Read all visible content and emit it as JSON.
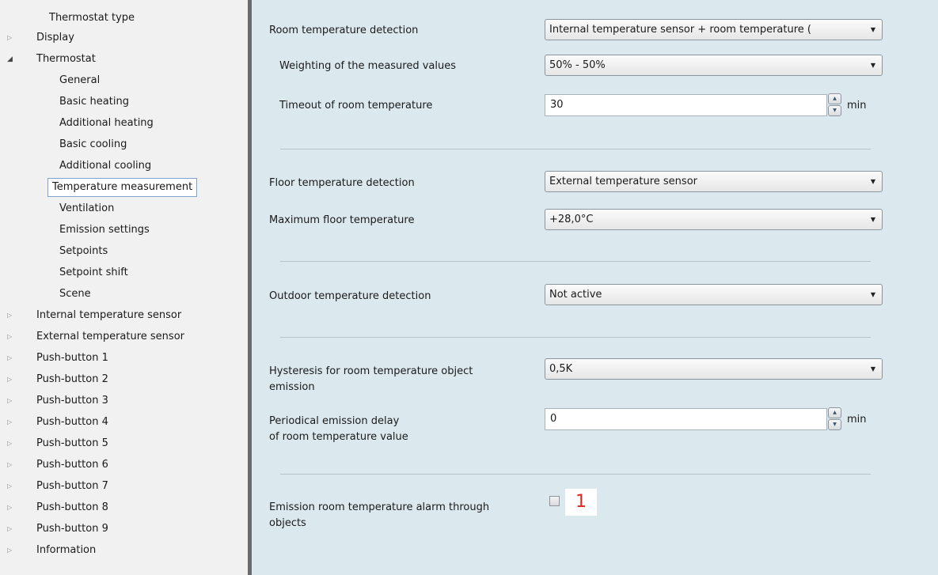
{
  "tree": {
    "items": [
      {
        "label": "Thermostat type",
        "arrow": ""
      },
      {
        "label": "Display",
        "arrow": "▷"
      },
      {
        "label": "Thermostat",
        "arrow": "◢"
      },
      {
        "label": "General",
        "arrow": ""
      },
      {
        "label": "Basic heating",
        "arrow": ""
      },
      {
        "label": "Additional heating",
        "arrow": ""
      },
      {
        "label": "Basic cooling",
        "arrow": ""
      },
      {
        "label": "Additional cooling",
        "arrow": ""
      },
      {
        "label": "Temperature measurement",
        "arrow": "",
        "selected": true
      },
      {
        "label": "Ventilation",
        "arrow": ""
      },
      {
        "label": "Emission settings",
        "arrow": ""
      },
      {
        "label": "Setpoints",
        "arrow": ""
      },
      {
        "label": "Setpoint shift",
        "arrow": ""
      },
      {
        "label": "Scene",
        "arrow": ""
      },
      {
        "label": "Internal temperature sensor",
        "arrow": "▷"
      },
      {
        "label": "External temperature sensor",
        "arrow": "▷"
      },
      {
        "label": "Push-button 1",
        "arrow": "▷"
      },
      {
        "label": "Push-button 2",
        "arrow": "▷"
      },
      {
        "label": "Push-button 3",
        "arrow": "▷"
      },
      {
        "label": "Push-button 4",
        "arrow": "▷"
      },
      {
        "label": "Push-button 5",
        "arrow": "▷"
      },
      {
        "label": "Push-button 6",
        "arrow": "▷"
      },
      {
        "label": "Push-button 7",
        "arrow": "▷"
      },
      {
        "label": "Push-button 8",
        "arrow": "▷"
      },
      {
        "label": "Push-button 9",
        "arrow": "▷"
      },
      {
        "label": "Information",
        "arrow": "▷"
      }
    ]
  },
  "panel": {
    "room_detection": {
      "label": "Room temperature detection",
      "value": "Internal temperature sensor + room temperature ("
    },
    "weighting": {
      "label": "Weighting of the measured values",
      "value": "50% - 50%"
    },
    "timeout": {
      "label": "Timeout of room temperature",
      "value": "30",
      "unit": "min"
    },
    "floor_detection": {
      "label": "Floor temperature detection",
      "value": "External temperature sensor"
    },
    "max_floor": {
      "label": "Maximum floor temperature",
      "value": "+28,0°C"
    },
    "outdoor_detection": {
      "label": "Outdoor temperature detection",
      "value": "Not active"
    },
    "hysteresis": {
      "label_line1": "Hysteresis for room temperature object",
      "label_line2": "emission",
      "value": "0,5K"
    },
    "periodical": {
      "label_line1": "Periodical emission delay",
      "label_line2": "of room temperature value",
      "value": "0",
      "unit": "min"
    },
    "alarm": {
      "label_line1": "Emission room temperature alarm through",
      "label_line2": "objects",
      "checked": false,
      "badge": "1"
    }
  },
  "icons": {
    "spin_up": "▲",
    "spin_down": "▼",
    "combo_arrow": "▼"
  },
  "colors": {
    "panel_bg": "#dbe9ef",
    "tree_bg": "#f1f1f1",
    "selection_border": "#7da2ce",
    "badge": "#e1251b"
  }
}
